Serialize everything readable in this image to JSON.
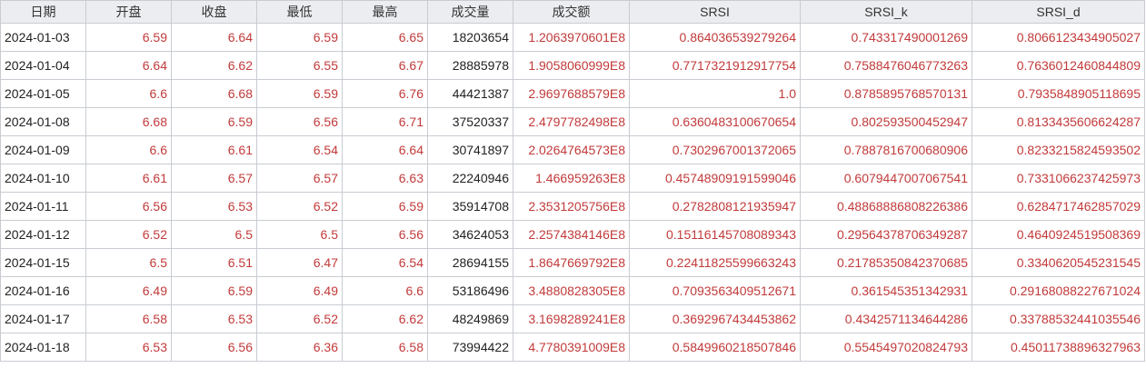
{
  "table": {
    "headers": [
      "日期",
      "开盘",
      "收盘",
      "最低",
      "最高",
      "成交量",
      "成交额",
      "SRSI",
      "SRSI_k",
      "SRSI_d"
    ],
    "rows": [
      [
        "2024-01-03",
        "6.59",
        "6.64",
        "6.59",
        "6.65",
        "18203654",
        "1.2063970601E8",
        "0.864036539279264",
        "0.743317490001269",
        "0.8066123434905027"
      ],
      [
        "2024-01-04",
        "6.64",
        "6.62",
        "6.55",
        "6.67",
        "28885978",
        "1.9058060999E8",
        "0.7717321912917754",
        "0.7588476046773263",
        "0.7636012460844809"
      ],
      [
        "2024-01-05",
        "6.6",
        "6.68",
        "6.59",
        "6.76",
        "44421387",
        "2.9697688579E8",
        "1.0",
        "0.8785895768570131",
        "0.7935848905118695"
      ],
      [
        "2024-01-08",
        "6.68",
        "6.59",
        "6.56",
        "6.71",
        "37520337",
        "2.4797782498E8",
        "0.6360483100670654",
        "0.802593500452947",
        "0.8133435606624287"
      ],
      [
        "2024-01-09",
        "6.6",
        "6.61",
        "6.54",
        "6.64",
        "30741897",
        "2.0264764573E8",
        "0.7302967001372065",
        "0.7887816700680906",
        "0.8233215824593502"
      ],
      [
        "2024-01-10",
        "6.61",
        "6.57",
        "6.57",
        "6.63",
        "22240946",
        "1.466959263E8",
        "0.45748909191599046",
        "0.6079447007067541",
        "0.7331066237425973"
      ],
      [
        "2024-01-11",
        "6.56",
        "6.53",
        "6.52",
        "6.59",
        "35914708",
        "2.3531205756E8",
        "0.2782808121935947",
        "0.48868886808226386",
        "0.6284717462857029"
      ],
      [
        "2024-01-12",
        "6.52",
        "6.5",
        "6.5",
        "6.56",
        "34624053",
        "2.2574384146E8",
        "0.15116145708089343",
        "0.29564378706349287",
        "0.4640924519508369"
      ],
      [
        "2024-01-15",
        "6.5",
        "6.51",
        "6.47",
        "6.54",
        "28694155",
        "1.8647669792E8",
        "0.22411825599663243",
        "0.21785350842370685",
        "0.3340620545231545"
      ],
      [
        "2024-01-16",
        "6.49",
        "6.59",
        "6.49",
        "6.6",
        "53186496",
        "3.4880828305E8",
        "0.7093563409512671",
        "0.361545351342931",
        "0.29168088227671024"
      ],
      [
        "2024-01-17",
        "6.58",
        "6.53",
        "6.52",
        "6.62",
        "48249869",
        "3.1698289241E8",
        "0.3692967434453862",
        "0.4342571134644286",
        "0.33788532441035546"
      ],
      [
        "2024-01-18",
        "6.53",
        "6.56",
        "6.36",
        "6.58",
        "73994422",
        "4.7780391009E8",
        "0.5849960218507846",
        "0.5545497020824793",
        "0.45011738896327963"
      ]
    ]
  }
}
